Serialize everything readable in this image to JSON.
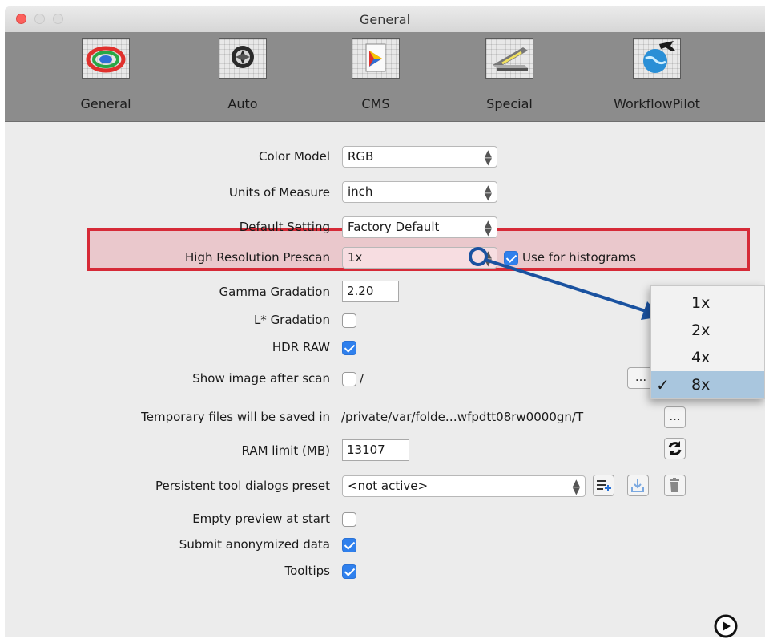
{
  "window": {
    "title": "General"
  },
  "toolbar": {
    "items": [
      {
        "label": "General"
      },
      {
        "label": "Auto"
      },
      {
        "label": "CMS"
      },
      {
        "label": "Special"
      },
      {
        "label": "WorkflowPilot"
      }
    ]
  },
  "settings": {
    "color_model": {
      "label": "Color Model",
      "value": "RGB"
    },
    "units": {
      "label": "Units of Measure",
      "value": "inch"
    },
    "default_setting": {
      "label": "Default Setting",
      "value": "Factory Default"
    },
    "prescan": {
      "label": "High Resolution Prescan",
      "value": "1x",
      "histograms_label": "Use for histograms",
      "histograms_checked": true
    },
    "gamma": {
      "label": "Gamma Gradation",
      "value": "2.20"
    },
    "lstar": {
      "label": "L* Gradation",
      "checked": false
    },
    "hdr_raw": {
      "label": "HDR RAW",
      "checked": true
    },
    "show_image": {
      "label": "Show image after scan",
      "checked": false,
      "path": "/",
      "browse": "..."
    },
    "temp_files": {
      "label": "Temporary files will be saved in",
      "path": "/private/var/folde…wfpdtt08rw0000gn/T",
      "browse": "..."
    },
    "ram_limit": {
      "label": "RAM limit (MB)",
      "value": "13107"
    },
    "tool_dialogs": {
      "label": "Persistent tool dialogs preset",
      "value": "<not active>"
    },
    "empty_preview": {
      "label": "Empty preview at start",
      "checked": false
    },
    "submit_data": {
      "label": "Submit anonymized data",
      "checked": true
    },
    "tooltips": {
      "label": "Tooltips",
      "checked": true
    }
  },
  "prescan_dropdown": {
    "options": [
      "1x",
      "2x",
      "4x",
      "8x"
    ],
    "selected": "8x",
    "check": "✓"
  },
  "colors": {
    "highlight_border": "#d62a37",
    "arrow": "#1a52a0",
    "checkbox_on": "#2f80ed",
    "dropdown_selected": "#a9c6de"
  }
}
